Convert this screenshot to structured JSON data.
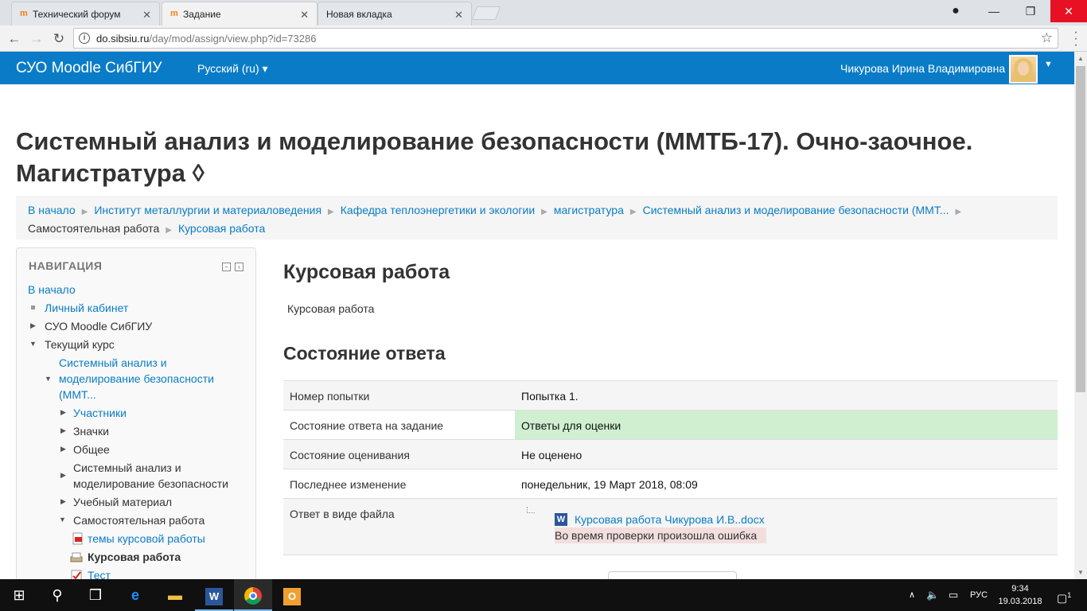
{
  "browser": {
    "tabs": [
      {
        "title": "Технический форум",
        "favicon": "moodle-icon"
      },
      {
        "title": "Задание",
        "favicon": "moodle-icon"
      },
      {
        "title": "Новая вкладка",
        "favicon": ""
      }
    ],
    "url_host": "do.sibsiu.ru",
    "url_path": "/day/mod/assign/view.php?id=73286"
  },
  "navbar": {
    "brand": "СУО Moodle СибГИУ",
    "language": "Русский (ru)",
    "user": "Чикурова Ирина Владимировна",
    "color": "#0a7cc7"
  },
  "page": {
    "title_line1": "Системный анализ и моделирование безопасности (ММТБ-17). Очно-заочное.",
    "title_line2": "Магистратура",
    "title_icon": "◊"
  },
  "breadcrumb": [
    "В начало",
    "Институт металлургии и материаловедения",
    "Кафедра теплоэнергетики и экологии",
    "магистратура",
    "Системный анализ и моделирование безопасности (ММТ...",
    "Самостоятельная работа",
    "Курсовая работа"
  ],
  "navigation": {
    "heading": "НАВИГАЦИЯ",
    "home": "В начало",
    "dashboard": "Личный кабинет",
    "site": "СУО Moodle СибГИУ",
    "current_course": "Текущий курс",
    "course_name_1": "Системный анализ и",
    "course_name_2": "моделирование безопасности",
    "course_name_3": "(ММТ...",
    "participants": "Участники",
    "badges": "Значки",
    "general": "Общее",
    "section_1": "Системный анализ и",
    "section_2": "моделирование безопасности",
    "study_material": "Учебный материал",
    "independent_work": "Самостоятельная работа",
    "topics": "темы курсовой работы",
    "coursework": "Курсовая работа",
    "test": "Тест"
  },
  "assignment": {
    "heading": "Курсовая работа",
    "description": "Курсовая работа",
    "status_heading": "Состояние ответа",
    "rows": [
      {
        "label": "Номер попытки",
        "value": "Попытка 1."
      },
      {
        "label": "Состояние ответа на задание",
        "value": "Ответы для оценки"
      },
      {
        "label": "Состояние оценивания",
        "value": "Не оценено"
      },
      {
        "label": "Последнее изменение",
        "value": "понедельник, 19 Март 2018, 08:09"
      },
      {
        "label": "Ответ в виде файла",
        "value": ""
      }
    ],
    "file_name": "Курсовая работа Чикурова И.В..docx",
    "file_error": "Во время проверки произошла ошибка"
  },
  "taskbar": {
    "lang": "РУС",
    "time": "9:34",
    "date": "19.03.2018",
    "notifications": "1"
  }
}
